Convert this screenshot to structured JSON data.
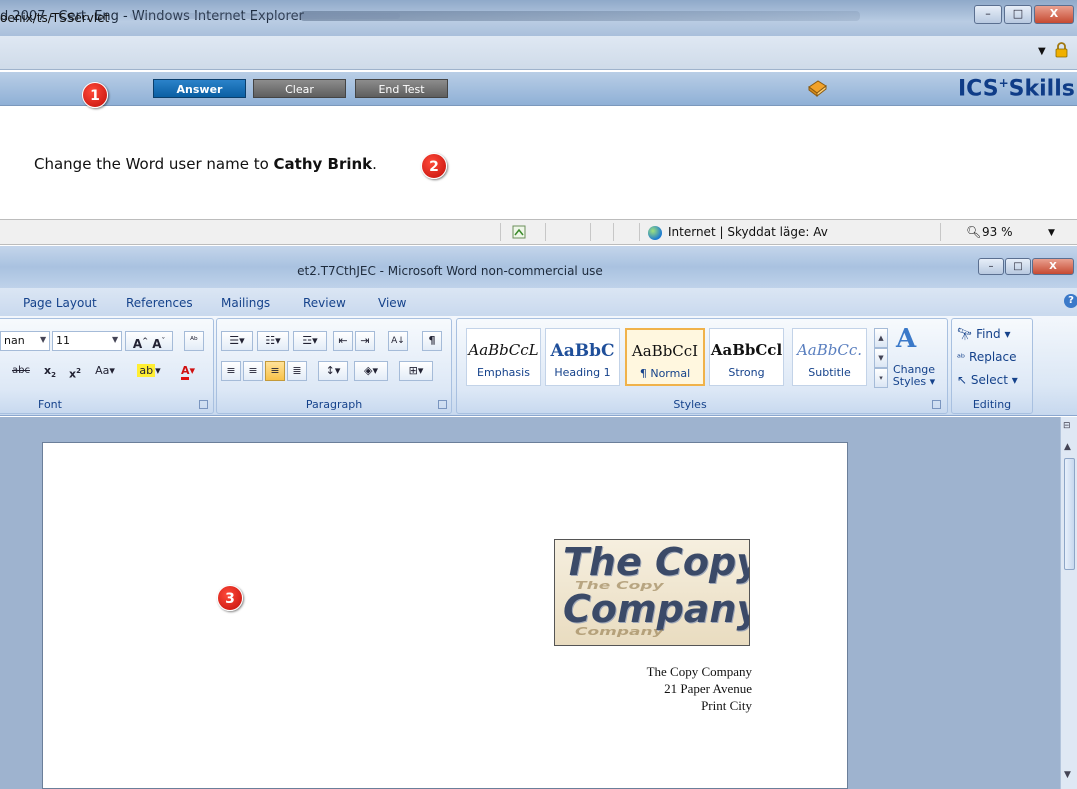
{
  "browser": {
    "title": "d 2007 - Cert. Eng - Windows Internet Explorer",
    "address": "oenix/ts/TSServlet",
    "window_buttons": [
      "–",
      "□",
      "X"
    ]
  },
  "test_toolbar": {
    "answer_label": "Answer",
    "clear_label": "Clear",
    "end_test_label": "End Test",
    "brand": "ICS",
    "brand_suffix": "Skills",
    "brand_plus": "+"
  },
  "badges": [
    "1",
    "2",
    "3"
  ],
  "question": {
    "prefix": "Change the Word user name to ",
    "emphasis": "Cathy Brink",
    "suffix": "."
  },
  "status_bar": {
    "zone": "Internet | Skyddat läge: Av",
    "zoom": "93 %"
  },
  "word": {
    "title": "et2.T7CthJEC - Microsoft Word non-commercial use",
    "tabs": [
      "Page Layout",
      "References",
      "Mailings",
      "Review",
      "View"
    ],
    "font": {
      "name": "nan",
      "size": "11",
      "group_label": "Font"
    },
    "paragraph_label": "Paragraph",
    "styles": {
      "group_label": "Styles",
      "tiles": [
        {
          "sample": "AaBbCcL",
          "name": "Emphasis"
        },
        {
          "sample": "AaBbC",
          "name": "Heading 1"
        },
        {
          "sample": "AaBbCcI",
          "name": "¶ Normal"
        },
        {
          "sample": "AaBbCcl",
          "name": "Strong"
        },
        {
          "sample": "AaBbCc.",
          "name": "Subtitle"
        }
      ],
      "change_styles_line1": "Change",
      "change_styles_line2": "Styles ▾"
    },
    "editing": {
      "group_label": "Editing",
      "find": "Find ▾",
      "replace": "Replace",
      "select": "Select ▾"
    }
  },
  "document": {
    "logo_line1": "The Copy",
    "logo_line2": "Company",
    "address_lines": [
      "The Copy Company",
      "21 Paper Avenue",
      "Print City"
    ]
  },
  "colors": {
    "accent": "#0a5fa3",
    "badge": "#d4140e",
    "word_blue": "#15428b"
  }
}
